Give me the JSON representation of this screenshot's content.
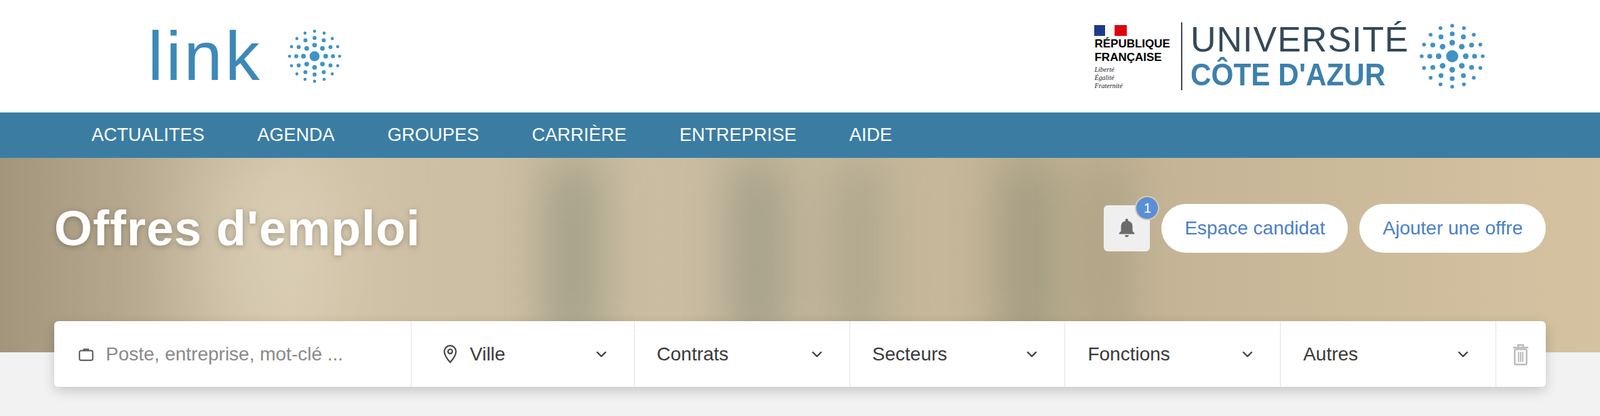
{
  "header": {
    "logo": {
      "text": "link"
    },
    "republique": {
      "lines": [
        "RÉPUBLIQUE",
        "FRANÇAISE"
      ],
      "motto": [
        "Liberté",
        "Égalité",
        "Fraternité"
      ]
    },
    "university": {
      "line1": "UNIVERSITÉ",
      "line2": "CÔTE D'AZUR"
    }
  },
  "nav": [
    "ACTUALITES",
    "AGENDA",
    "GROUPES",
    "CARRIÈRE",
    "ENTREPRISE",
    "AIDE"
  ],
  "hero": {
    "title": "Offres d'emploi",
    "notifications": {
      "count": "1"
    },
    "buttons": [
      "Espace candidat",
      "Ajouter une offre"
    ]
  },
  "search": {
    "placeholder": "Poste, entreprise, mot-clé ...",
    "filters": [
      {
        "label": "Ville",
        "kind": "location"
      },
      {
        "label": "Contrats",
        "kind": "plain"
      },
      {
        "label": "Secteurs",
        "kind": "plain"
      },
      {
        "label": "Fonctions",
        "kind": "plain"
      },
      {
        "label": "Autres",
        "kind": "plain"
      }
    ]
  }
}
